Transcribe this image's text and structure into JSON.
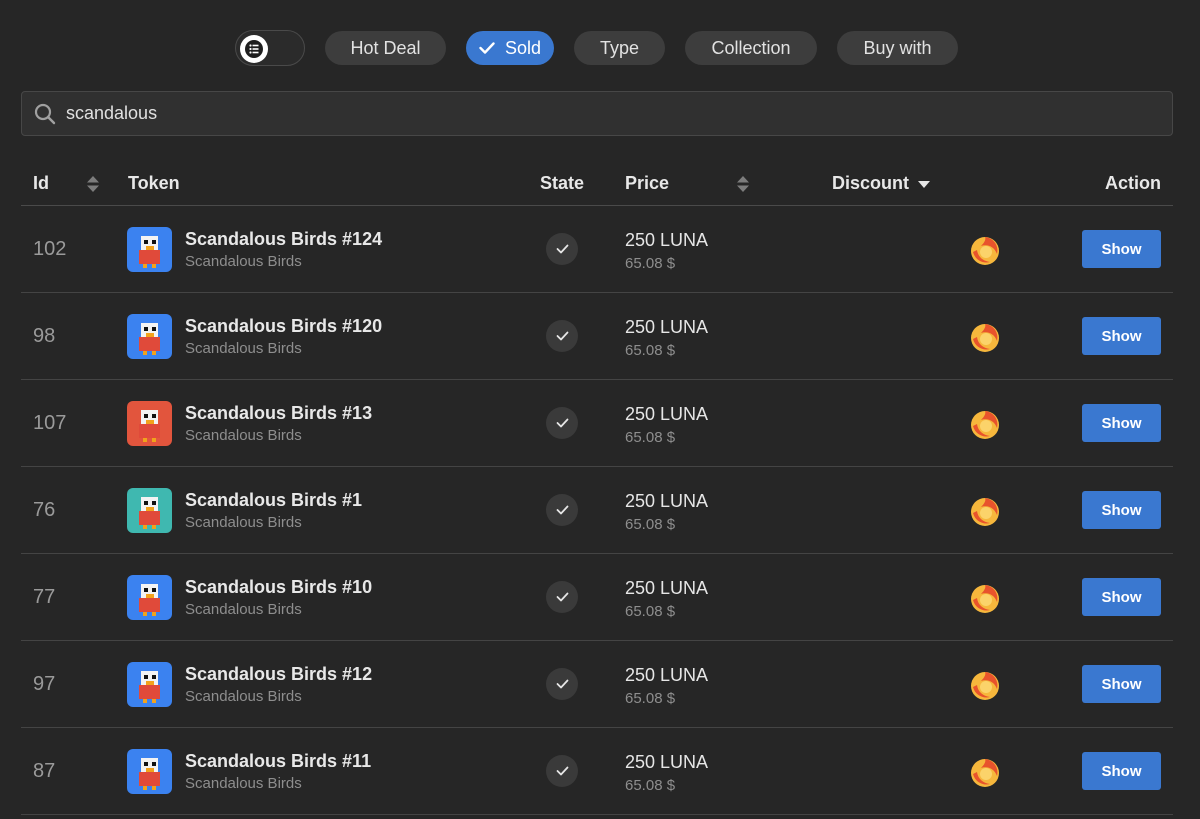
{
  "filters": {
    "hot_deal": "Hot Deal",
    "sold": "Sold",
    "type": "Type",
    "collection": "Collection",
    "buy_with": "Buy with"
  },
  "search": {
    "value": "scandalous",
    "icon": "search-icon"
  },
  "columns": {
    "id": "Id",
    "token": "Token",
    "state": "State",
    "price": "Price",
    "discount": "Discount",
    "action": "Action"
  },
  "colors": {
    "background": "#262626",
    "accent": "#3a78d0",
    "pill": "#3d3d3d"
  },
  "rows": [
    {
      "id": "102",
      "name": "Scandalous Birds #124",
      "collection": "Scandalous Birds",
      "price": "250 LUNA",
      "usd": "65.08 $",
      "action": "Show",
      "thumb_bg": "#3b82f0"
    },
    {
      "id": "98",
      "name": "Scandalous Birds #120",
      "collection": "Scandalous Birds",
      "price": "250 LUNA",
      "usd": "65.08 $",
      "action": "Show",
      "thumb_bg": "#3b82f0"
    },
    {
      "id": "107",
      "name": "Scandalous Birds #13",
      "collection": "Scandalous Birds",
      "price": "250 LUNA",
      "usd": "65.08 $",
      "action": "Show",
      "thumb_bg": "#e2553d"
    },
    {
      "id": "76",
      "name": "Scandalous Birds #1",
      "collection": "Scandalous Birds",
      "price": "250 LUNA",
      "usd": "65.08 $",
      "action": "Show",
      "thumb_bg": "#3fb8b0"
    },
    {
      "id": "77",
      "name": "Scandalous Birds #10",
      "collection": "Scandalous Birds",
      "price": "250 LUNA",
      "usd": "65.08 $",
      "action": "Show",
      "thumb_bg": "#3b82f0"
    },
    {
      "id": "97",
      "name": "Scandalous Birds #12",
      "collection": "Scandalous Birds",
      "price": "250 LUNA",
      "usd": "65.08 $",
      "action": "Show",
      "thumb_bg": "#3b82f0"
    },
    {
      "id": "87",
      "name": "Scandalous Birds #11",
      "collection": "Scandalous Birds",
      "price": "250 LUNA",
      "usd": "65.08 $",
      "action": "Show",
      "thumb_bg": "#3b82f0"
    }
  ]
}
